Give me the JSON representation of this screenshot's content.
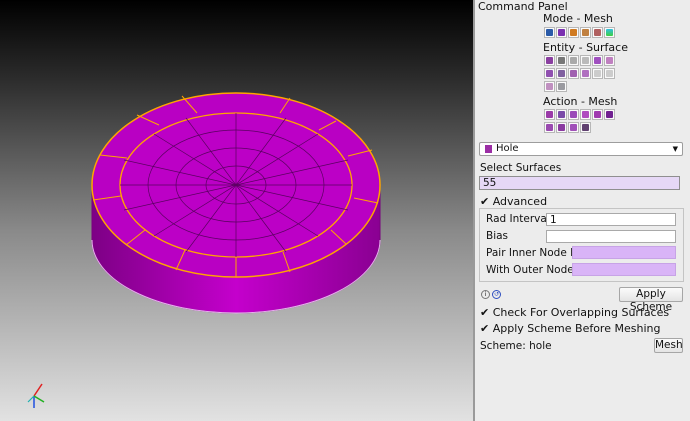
{
  "panel": {
    "title": "Command Panel",
    "mode_label": "Mode - Mesh",
    "entity_label": "Entity - Surface",
    "action_label": "Action - Mesh",
    "mode_icons": [
      "mesh-mode-icon",
      "volume-icon",
      "surface-cube-icon",
      "curve-icon",
      "vertex-icon",
      "quality-icon"
    ],
    "entity_icons": [
      "cube-surface-icon",
      "sheet-icon",
      "curve-tool-icon",
      "plus-icon",
      "surface-color-icon",
      "tree-icon",
      "vertex-icon",
      "triangle-icon",
      "a-shape-icon",
      "triangle-mesh-icon",
      "minus-icon",
      "cross-icon",
      "grid-icon",
      "check-grid-icon"
    ],
    "action_icons": [
      "scheme-icon",
      "interval-icon",
      "sizing-icon",
      "mesh-box-icon",
      "smooth-icon",
      "delete-mesh-icon",
      "quad-mesh-icon",
      "pave-icon",
      "map-icon",
      "layers-icon"
    ],
    "icon_colors": [
      "#5050c8",
      "#8a3fa0",
      "#d07a20",
      "#2c7b2c",
      "#c0302a",
      "#3b9ad6"
    ],
    "scheme_dropdown": "Hole",
    "select_surfaces_label": "Select Surfaces",
    "select_surfaces_value": "55",
    "advanced_label": "Advanced",
    "rad_intervals_label": "Rad Intervals",
    "rad_intervals_value": "1",
    "bias_label": "Bias",
    "bias_value": "",
    "pair_inner_label": "Pair Inner Node ID",
    "with_outer_label": "With Outer Node ID",
    "apply_scheme_button": "Apply Scheme",
    "check_overlap_label": "Check For Overlapping Surfaces",
    "apply_before_label": "Apply Scheme Before Meshing",
    "scheme_status": "Scheme: hole",
    "mesh_button": "Mesh",
    "check_mark": "✔"
  },
  "viewport": {
    "model_color": "#c000c8",
    "highlight_color": "#ffa500"
  }
}
